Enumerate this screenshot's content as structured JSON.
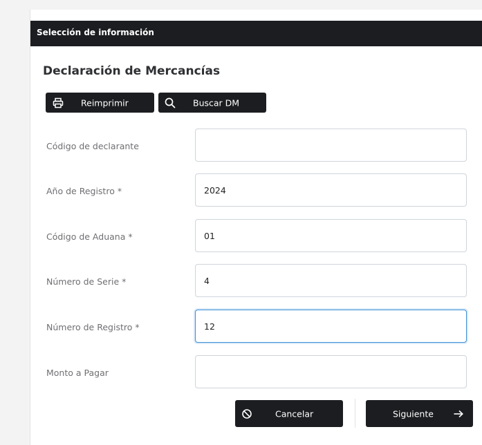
{
  "panel": {
    "header_title": "Selección de información"
  },
  "page": {
    "title": "Declaración de Mercancías"
  },
  "toolbar": {
    "reprint_label": "Reimprimir",
    "reprint_icon": "printer-icon",
    "search_label": "Buscar DM",
    "search_icon": "search-icon"
  },
  "form": {
    "fields": [
      {
        "label": "Código de declarante",
        "value": ""
      },
      {
        "label": "Año de Registro *",
        "value": "2024"
      },
      {
        "label": "Código de Aduana *",
        "value": "01"
      },
      {
        "label": "Número de Serie *",
        "value": "4"
      },
      {
        "label": "Número de Registro *",
        "value": "12",
        "focused": true
      },
      {
        "label": "Monto a Pagar",
        "value": ""
      }
    ]
  },
  "footer": {
    "cancel_label": "Cancelar",
    "cancel_icon": "ban-icon",
    "next_label": "Siguiente",
    "next_icon": "arrow-right-icon"
  },
  "colors": {
    "header_bg": "#1b1d20",
    "button_bg": "#1b1d20",
    "focus_border": "#3b8fd6",
    "label_text": "#6f6f73"
  }
}
